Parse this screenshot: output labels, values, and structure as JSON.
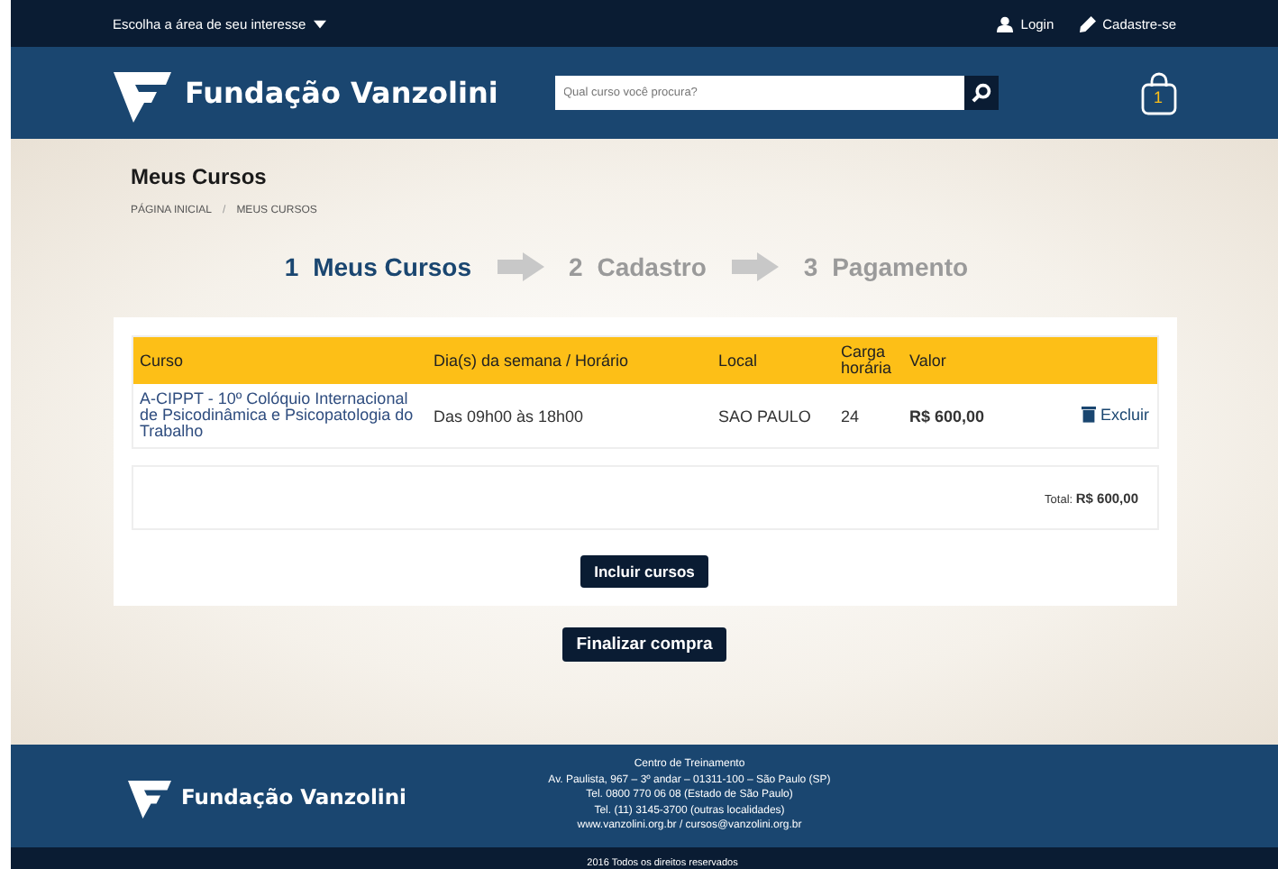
{
  "top_bar": {
    "area_menu": "Escolha a área de seu interesse",
    "links": [
      {
        "kind": "user",
        "label": "Login"
      },
      {
        "kind": "pencil",
        "label": "Cadastre-se"
      }
    ]
  },
  "header": {
    "logo_text": "Fundação Vanzolini",
    "search": {
      "placeholder": "Qual curso você procura?"
    },
    "cart_count": "1"
  },
  "page": {
    "title": "Meus Cursos",
    "breadcrumb": [
      "PÁGINA INICIAL",
      "MEUS CURSOS"
    ],
    "breadcrumb_separator": "/"
  },
  "steps": [
    {
      "number": "1",
      "label": "Meus Cursos",
      "selected": true
    },
    {
      "number": "2",
      "label": "Cadastro",
      "selected": false
    },
    {
      "number": "3",
      "label": "Pagamento",
      "selected": false
    }
  ],
  "table": {
    "columns": [
      "Curso",
      "Dia(s) da semana / Horário",
      "Local",
      "Carga horária",
      "Valor"
    ],
    "rows": [
      {
        "course": "A-CIPPT - 10º Colóquio Internacional de Psicodinâmica e Psicopatologia do Trabalho",
        "schedule": "Das 09h00 às 18h00",
        "location": "SAO PAULO",
        "hours": "24",
        "price": "R$ 600,00",
        "remove": "Excluir"
      }
    ],
    "total_label": "Total:",
    "total_value": "R$ 600,00"
  },
  "buttons": {
    "add": "Incluir cursos",
    "checkout": "Finalizar compra"
  },
  "footer": {
    "logo_text": "Fundação Vanzolini",
    "address": [
      "Centro de Treinamento",
      "Av. Paulista, 967 – 3º andar – 01311-100 – São Paulo (SP)",
      "Tel. 0800 770 06 08 (Estado de São Paulo)",
      "Tel. (11) 3145-3700 (outras localidades)",
      "www.vanzolini.org.br / cursos@vanzolini.org.br"
    ],
    "copyright": "2016 Todos os direitos reservados"
  }
}
